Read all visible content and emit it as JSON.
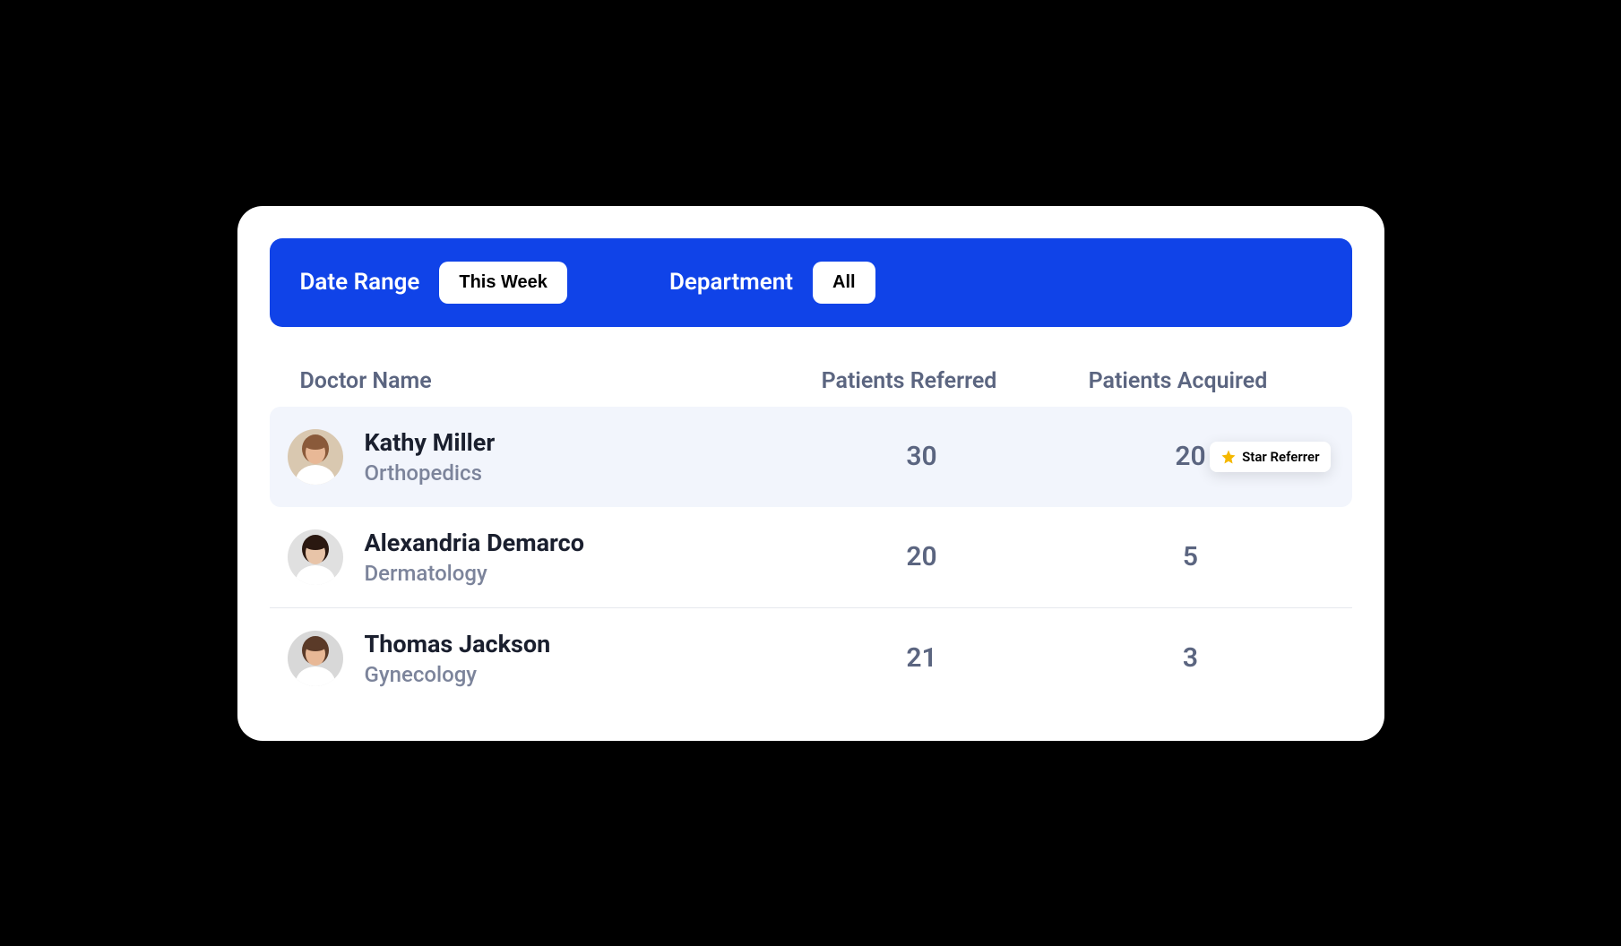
{
  "filters": {
    "dateRange": {
      "label": "Date Range",
      "value": "This Week"
    },
    "department": {
      "label": "Department",
      "value": "All"
    }
  },
  "table": {
    "headers": {
      "name": "Doctor Name",
      "referred": "Patients Referred",
      "acquired": "Patients Acquired"
    },
    "rows": [
      {
        "name": "Kathy Miller",
        "department": "Orthopedics",
        "referred": "30",
        "acquired": "20",
        "highlighted": true,
        "badge": "Star Referrer",
        "avatar": {
          "bg": "#d9c8b0",
          "hair": "#8a5a3a",
          "skin": "#e8b896"
        }
      },
      {
        "name": "Alexandria Demarco",
        "department": "Dermatology",
        "referred": "20",
        "acquired": "5",
        "highlighted": false,
        "badge": null,
        "avatar": {
          "bg": "#e0e0e0",
          "hair": "#2a1810",
          "skin": "#e8c4a8"
        }
      },
      {
        "name": "Thomas Jackson",
        "department": "Gynecology",
        "referred": "21",
        "acquired": "3",
        "highlighted": false,
        "badge": null,
        "avatar": {
          "bg": "#d8d8d8",
          "hair": "#5a3a28",
          "skin": "#e8b896"
        }
      }
    ]
  }
}
